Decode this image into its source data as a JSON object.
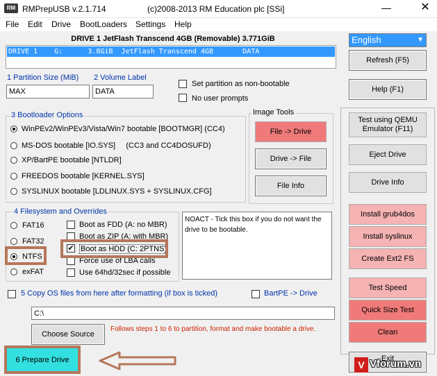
{
  "window": {
    "app_icon_text": "RM",
    "title": "RMPrepUSB v.2.1.714",
    "copyright": "(c)2008-2013 RM Education plc [SSi]",
    "minimize_glyph": "—",
    "close_glyph": "✕"
  },
  "menu": [
    "File",
    "Edit",
    "Drive",
    "BootLoaders",
    "Settings",
    "Help"
  ],
  "drive": {
    "header": "DRIVE 1  JetFlash Transcend 4GB  (Removable) 3.771GiB",
    "row": "DRIVE 1    G:      3.8GiB  JetFlash Transcend 4GB       DATA"
  },
  "language": {
    "selected": "English"
  },
  "fields": {
    "partition_size_label": "1 Partition Size (MiB)",
    "partition_size_value": "MAX",
    "volume_label_label": "2 Volume Label",
    "volume_label_value": "DATA",
    "non_bootable_label": "Set partition as non-bootable",
    "no_prompts_label": "No user prompts"
  },
  "bootloader": {
    "title": "3 Bootloader Options",
    "options": [
      "WinPEv2/WinPEv3/Vista/Win7 bootable [BOOTMGR] (CC4)",
      "MS-DOS bootable [IO.SYS]     (CC3 and CC4DOSUFD)",
      "XP/BartPE bootable [NTLDR]",
      "FREEDOS bootable [KERNEL.SYS]",
      "SYSLINUX bootable [LDLINUX.SYS + SYSLINUX.CFG]"
    ],
    "selected_index": 0
  },
  "image_tools": {
    "title": "Image Tools",
    "file_to_drive": "File -> Drive",
    "drive_to_file": "Drive -> File",
    "file_info": "File Info"
  },
  "filesystem": {
    "title": "4 Filesystem and Overrides",
    "fs_options": [
      "FAT16",
      "FAT32",
      "NTFS",
      "exFAT"
    ],
    "selected_fs": "NTFS",
    "overrides": [
      "Boot as FDD (A: no MBR)",
      "Boot as ZIP (A: with MBR)",
      "Boot as HDD (C: 2PTNS)",
      "Force use of LBA calls",
      "Use 64hd/32sec if possible"
    ],
    "checked_override": "Boot as HDD (C: 2PTNS)",
    "check_mark": "✔"
  },
  "info_text": "NOACT - Tick this box if you do not want the drive to be bootable.",
  "copy_os": {
    "label": "5 Copy OS files from here after formatting (if box is ticked)",
    "bartpe_label": "BartPE -> Drive",
    "path": "C:\\"
  },
  "choose_source": "Choose Source",
  "follow_steps": "Follows steps 1 to 6 to partition, format and make bootable a drive.",
  "prepare_drive": "6 Prepare Drive",
  "right_buttons": {
    "refresh": "Refresh (F5)",
    "help": "Help (F1)",
    "qemu": "Test using QEMU Emulator (F11)",
    "eject": "Eject Drive",
    "drive_info": "Drive Info",
    "grub4dos": "Install grub4dos",
    "syslinux": "Install syslinux",
    "ext2": "Create Ext2 FS",
    "test_speed": "Test Speed",
    "quick_size": "Quick Size Test",
    "clean": "Clean",
    "exit_partial": "Exit"
  },
  "watermark": {
    "logo": "V",
    "text": "Vforum.vn"
  },
  "colors": {
    "selection": "#3399ff",
    "pink_button": "#f5b3b3",
    "red_button": "#f07a7a",
    "prepare_button": "#33e0e0",
    "annotation": "#b5775a",
    "hint_text": "#cc2200"
  }
}
